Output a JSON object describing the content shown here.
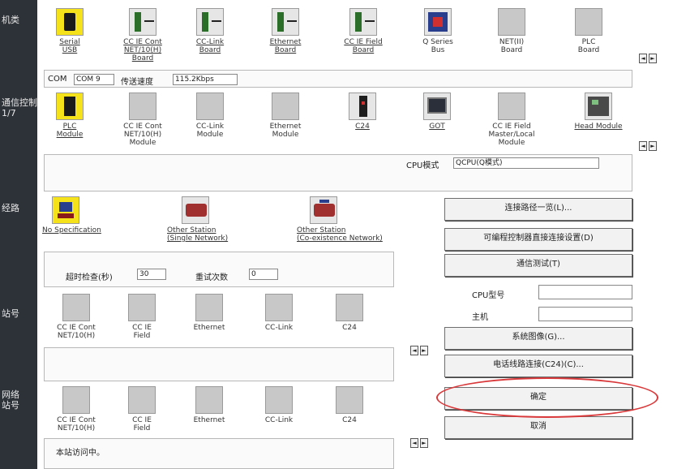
{
  "left_labels": [
    "机类",
    "通信控制\n1/7",
    "经路",
    "站号",
    "网络\n站号"
  ],
  "row1_icons": [
    {
      "label": "Serial\nUSB",
      "icon": "serial-usb-icon"
    },
    {
      "label": "CC IE Cont\nNET/10(H)\nBoard",
      "icon": "cc-ie-cont-board-icon"
    },
    {
      "label": "CC-Link\nBoard",
      "icon": "cc-link-board-icon"
    },
    {
      "label": "Ethernet\nBoard",
      "icon": "ethernet-board-icon"
    },
    {
      "label": "CC IE Field\nBoard",
      "icon": "cc-ie-field-board-icon"
    },
    {
      "label": "Q Series\nBus",
      "icon": "q-series-bus-icon"
    },
    {
      "label": "NET(II)\nBoard",
      "icon": "net-ii-board-icon"
    },
    {
      "label": "PLC\nBoard",
      "icon": "plc-board-icon"
    }
  ],
  "com_bar": {
    "com_label": "COM",
    "com_value": "COM 9",
    "speed_label": "传送速度",
    "speed_value": "115.2Kbps"
  },
  "row2_icons": [
    {
      "label": "PLC\nModule",
      "icon": "plc-module-icon"
    },
    {
      "label": "CC IE Cont\nNET/10(H)\nModule",
      "icon": "cc-ie-cont-module-icon"
    },
    {
      "label": "CC-Link\nModule",
      "icon": "cc-link-module-icon"
    },
    {
      "label": "Ethernet\nModule",
      "icon": "ethernet-module-icon"
    },
    {
      "label": "C24",
      "icon": "c24-icon"
    },
    {
      "label": "GOT",
      "icon": "got-icon"
    },
    {
      "label": "CC IE Field\nMaster/Local\nModule",
      "icon": "cc-ie-field-master-icon"
    },
    {
      "label": "Head Module",
      "icon": "head-module-icon"
    }
  ],
  "cpu_mode": {
    "label": "CPU模式",
    "value": "QCPU(Q模式)"
  },
  "row3_icons": [
    {
      "label": "No Specification",
      "icon": "no-specification-icon"
    },
    {
      "label": "Other Station\n(Single Network)",
      "icon": "other-station-single-icon"
    },
    {
      "label": "Other Station\n(Co-existence Network)",
      "icon": "other-station-coexistence-icon"
    }
  ],
  "timeout": {
    "label": "超时检查(秒)",
    "value": "30",
    "retry_label": "重试次数",
    "retry_value": "0"
  },
  "row4_icons": [
    {
      "label": "CC IE Cont\nNET/10(H)",
      "icon": "cc-ie-cont-icon"
    },
    {
      "label": "CC IE\nField",
      "icon": "cc-ie-field-icon"
    },
    {
      "label": "Ethernet",
      "icon": "ethernet-icon"
    },
    {
      "label": "CC-Link",
      "icon": "cc-link-icon"
    },
    {
      "label": "C24",
      "icon": "c24-icon"
    }
  ],
  "row5_icons": [
    {
      "label": "CC IE Cont\nNET/10(H)",
      "icon": "cc-ie-cont-icon"
    },
    {
      "label": "CC IE\nField",
      "icon": "cc-ie-field-icon"
    },
    {
      "label": "Ethernet",
      "icon": "ethernet-icon"
    },
    {
      "label": "CC-Link",
      "icon": "cc-link-icon"
    },
    {
      "label": "C24",
      "icon": "c24-icon"
    }
  ],
  "status_text": "本站访问中。",
  "buttons": {
    "connection_list": "连接路径一览(L)...",
    "programmable_controller": "可编程控制器直接连接设置(D)",
    "connection_test": "通信测试(T)",
    "system_image": "系统图像(G)...",
    "phone_line": "电话线路连接(C24)(C)...",
    "ok": "确定",
    "cancel": "取消"
  },
  "cpu_fields": {
    "cpu_type_label": "CPU型号",
    "host_label": "主机"
  },
  "arrows": {
    "left": "◄",
    "right": "►"
  }
}
